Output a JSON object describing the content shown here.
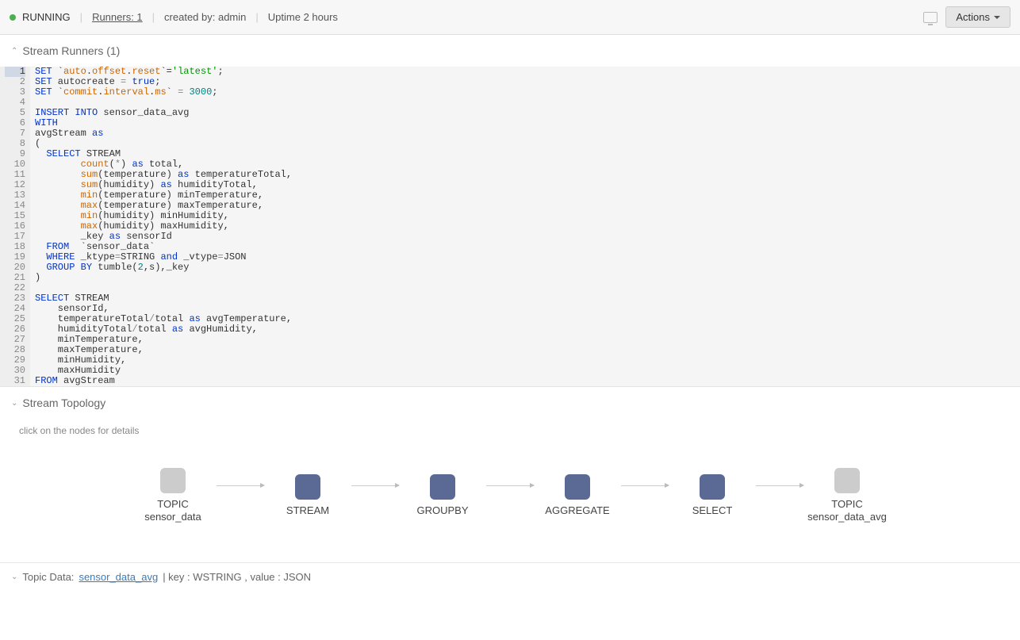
{
  "topbar": {
    "status": "RUNNING",
    "runners_label": "Runners: 1",
    "created_by": "created by: admin",
    "uptime": "Uptime 2 hours",
    "actions_label": "Actions"
  },
  "runners_section": {
    "title": "Stream Runners (1)"
  },
  "code": {
    "lines": [
      {
        "n": 1,
        "active": true,
        "tokens": [
          {
            "t": "kw",
            "v": "SET"
          },
          {
            "t": "",
            "v": " `"
          },
          {
            "t": "fn",
            "v": "auto"
          },
          {
            "t": "",
            "v": "."
          },
          {
            "t": "fn",
            "v": "offset"
          },
          {
            "t": "",
            "v": "."
          },
          {
            "t": "fn",
            "v": "reset"
          },
          {
            "t": "",
            "v": "`="
          },
          {
            "t": "str",
            "v": "'latest'"
          },
          {
            "t": "",
            "v": ";"
          }
        ]
      },
      {
        "n": 2,
        "tokens": [
          {
            "t": "kw",
            "v": "SET"
          },
          {
            "t": "",
            "v": " autocreate "
          },
          {
            "t": "op",
            "v": "="
          },
          {
            "t": "",
            "v": " "
          },
          {
            "t": "kw",
            "v": "true"
          },
          {
            "t": "",
            "v": ";"
          }
        ]
      },
      {
        "n": 3,
        "tokens": [
          {
            "t": "kw",
            "v": "SET"
          },
          {
            "t": "",
            "v": " `"
          },
          {
            "t": "fn",
            "v": "commit"
          },
          {
            "t": "",
            "v": "."
          },
          {
            "t": "fn",
            "v": "interval"
          },
          {
            "t": "",
            "v": "."
          },
          {
            "t": "fn",
            "v": "ms"
          },
          {
            "t": "",
            "v": "` "
          },
          {
            "t": "op",
            "v": "="
          },
          {
            "t": "",
            "v": " "
          },
          {
            "t": "num",
            "v": "3000"
          },
          {
            "t": "",
            "v": ";"
          }
        ]
      },
      {
        "n": 4,
        "tokens": []
      },
      {
        "n": 5,
        "tokens": [
          {
            "t": "kw",
            "v": "INSERT INTO"
          },
          {
            "t": "",
            "v": " sensor_data_avg"
          }
        ]
      },
      {
        "n": 6,
        "tokens": [
          {
            "t": "kw",
            "v": "WITH"
          }
        ]
      },
      {
        "n": 7,
        "tokens": [
          {
            "t": "",
            "v": "avgStream "
          },
          {
            "t": "kw",
            "v": "as"
          }
        ]
      },
      {
        "n": 8,
        "tokens": [
          {
            "t": "",
            "v": "("
          }
        ]
      },
      {
        "n": 9,
        "tokens": [
          {
            "t": "",
            "v": "  "
          },
          {
            "t": "kw",
            "v": "SELECT"
          },
          {
            "t": "",
            "v": " STREAM"
          }
        ]
      },
      {
        "n": 10,
        "tokens": [
          {
            "t": "",
            "v": "        "
          },
          {
            "t": "fn",
            "v": "count"
          },
          {
            "t": "",
            "v": "("
          },
          {
            "t": "op",
            "v": "*"
          },
          {
            "t": "",
            "v": ") "
          },
          {
            "t": "kw",
            "v": "as"
          },
          {
            "t": "",
            "v": " total,"
          }
        ]
      },
      {
        "n": 11,
        "tokens": [
          {
            "t": "",
            "v": "        "
          },
          {
            "t": "fn",
            "v": "sum"
          },
          {
            "t": "",
            "v": "(temperature) "
          },
          {
            "t": "kw",
            "v": "as"
          },
          {
            "t": "",
            "v": " temperatureTotal,"
          }
        ]
      },
      {
        "n": 12,
        "tokens": [
          {
            "t": "",
            "v": "        "
          },
          {
            "t": "fn",
            "v": "sum"
          },
          {
            "t": "",
            "v": "(humidity) "
          },
          {
            "t": "kw",
            "v": "as"
          },
          {
            "t": "",
            "v": " humidityTotal,"
          }
        ]
      },
      {
        "n": 13,
        "tokens": [
          {
            "t": "",
            "v": "        "
          },
          {
            "t": "fn",
            "v": "min"
          },
          {
            "t": "",
            "v": "(temperature) minTemperature,"
          }
        ]
      },
      {
        "n": 14,
        "tokens": [
          {
            "t": "",
            "v": "        "
          },
          {
            "t": "fn",
            "v": "max"
          },
          {
            "t": "",
            "v": "(temperature) maxTemperature,"
          }
        ]
      },
      {
        "n": 15,
        "tokens": [
          {
            "t": "",
            "v": "        "
          },
          {
            "t": "fn",
            "v": "min"
          },
          {
            "t": "",
            "v": "(humidity) minHumidity,"
          }
        ]
      },
      {
        "n": 16,
        "tokens": [
          {
            "t": "",
            "v": "        "
          },
          {
            "t": "fn",
            "v": "max"
          },
          {
            "t": "",
            "v": "(humidity) maxHumidity,"
          }
        ]
      },
      {
        "n": 17,
        "tokens": [
          {
            "t": "",
            "v": "        _key "
          },
          {
            "t": "kw",
            "v": "as"
          },
          {
            "t": "",
            "v": " sensorId"
          }
        ]
      },
      {
        "n": 18,
        "tokens": [
          {
            "t": "",
            "v": "  "
          },
          {
            "t": "kw",
            "v": "FROM"
          },
          {
            "t": "",
            "v": "  `sensor_data`"
          }
        ]
      },
      {
        "n": 19,
        "tokens": [
          {
            "t": "",
            "v": "  "
          },
          {
            "t": "kw",
            "v": "WHERE"
          },
          {
            "t": "",
            "v": " _ktype"
          },
          {
            "t": "op",
            "v": "="
          },
          {
            "t": "",
            "v": "STRING "
          },
          {
            "t": "kw",
            "v": "and"
          },
          {
            "t": "",
            "v": " _vtype"
          },
          {
            "t": "op",
            "v": "="
          },
          {
            "t": "",
            "v": "JSON"
          }
        ]
      },
      {
        "n": 20,
        "tokens": [
          {
            "t": "",
            "v": "  "
          },
          {
            "t": "kw",
            "v": "GROUP BY"
          },
          {
            "t": "",
            "v": " tumble("
          },
          {
            "t": "num",
            "v": "2"
          },
          {
            "t": "",
            "v": ",s),_key"
          }
        ]
      },
      {
        "n": 21,
        "tokens": [
          {
            "t": "",
            "v": ")"
          }
        ]
      },
      {
        "n": 22,
        "tokens": []
      },
      {
        "n": 23,
        "tokens": [
          {
            "t": "kw",
            "v": "SELECT"
          },
          {
            "t": "",
            "v": " STREAM"
          }
        ]
      },
      {
        "n": 24,
        "tokens": [
          {
            "t": "",
            "v": "    sensorId,"
          }
        ]
      },
      {
        "n": 25,
        "tokens": [
          {
            "t": "",
            "v": "    temperatureTotal"
          },
          {
            "t": "op",
            "v": "/"
          },
          {
            "t": "",
            "v": "total "
          },
          {
            "t": "kw",
            "v": "as"
          },
          {
            "t": "",
            "v": " avgTemperature,"
          }
        ]
      },
      {
        "n": 26,
        "tokens": [
          {
            "t": "",
            "v": "    humidityTotal"
          },
          {
            "t": "op",
            "v": "/"
          },
          {
            "t": "",
            "v": "total "
          },
          {
            "t": "kw",
            "v": "as"
          },
          {
            "t": "",
            "v": " avgHumidity,"
          }
        ]
      },
      {
        "n": 27,
        "tokens": [
          {
            "t": "",
            "v": "    minTemperature,"
          }
        ]
      },
      {
        "n": 28,
        "tokens": [
          {
            "t": "",
            "v": "    maxTemperature,"
          }
        ]
      },
      {
        "n": 29,
        "tokens": [
          {
            "t": "",
            "v": "    minHumidity,"
          }
        ]
      },
      {
        "n": 30,
        "tokens": [
          {
            "t": "",
            "v": "    maxHumidity"
          }
        ]
      },
      {
        "n": 31,
        "tokens": [
          {
            "t": "kw",
            "v": "FROM"
          },
          {
            "t": "",
            "v": " avgStream"
          }
        ]
      }
    ]
  },
  "topology": {
    "title": "Stream Topology",
    "hint": "click on the nodes for details",
    "nodes": [
      {
        "label": "TOPIC",
        "sub": "sensor_data",
        "color": "gray"
      },
      {
        "label": "STREAM",
        "sub": "",
        "color": "blue"
      },
      {
        "label": "GROUPBY",
        "sub": "",
        "color": "blue"
      },
      {
        "label": "AGGREGATE",
        "sub": "",
        "color": "blue"
      },
      {
        "label": "SELECT",
        "sub": "",
        "color": "blue"
      },
      {
        "label": "TOPIC",
        "sub": "sensor_data_avg",
        "color": "gray"
      }
    ]
  },
  "topic_data": {
    "prefix": "Topic Data:",
    "link": "sensor_data_avg",
    "suffix": "| key : WSTRING , value : JSON"
  }
}
